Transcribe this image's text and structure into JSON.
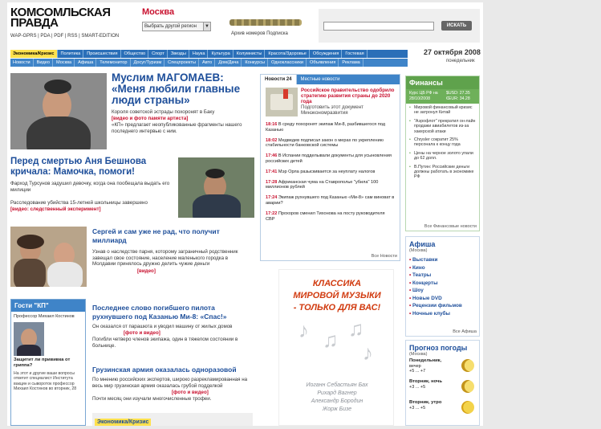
{
  "header": {
    "logo_line1_a": "КОМСОМ",
    "logo_line1_b": "ЛЬСКАЯ",
    "logo_line2": "ПРАВДА",
    "sublinks": "WAP-GPRS | PDA | PDF | RSS | SMART-EDITION",
    "city": "Москва",
    "region_select": "Выбрать другой регион",
    "archive_links": "Архив номеров   Подписка",
    "search_button": "ИСКАТЬ",
    "search_placeholder": ""
  },
  "nav": {
    "row1": [
      "Экономика/Кризис",
      "Политика",
      "Происшествия",
      "Общество",
      "Спорт",
      "Звезды",
      "Наука",
      "Культура",
      "Колумнисты",
      "Красота/Здоровье",
      "Обсуждения",
      "Гостевая"
    ],
    "row2": [
      "Новости",
      "Видео",
      "Москва",
      "Афиша",
      "Телемонитор",
      "Досуг/Туризм",
      "Спецпроекты",
      "Авто",
      "Дом/Дача",
      "Конкурсы",
      "Одноклассники",
      "Объявления",
      "Реклама"
    ]
  },
  "date": {
    "date": "27 октября 2008",
    "weekday": "понедельник"
  },
  "articles": {
    "a1_title": "Муслим МАГОМАЕВ: «Меня любили главные люди страны»",
    "a1_text": "Короля советской эстрады похоронят в Баку",
    "a1_link": "[видео и фото памяти артиста]",
    "a1_text2": "«КП» предлагает неопубликованные фрагменты нашего последнего интервью с ним.",
    "a2_title": "Перед смертью Аня Бешнова кричала: Мамочка, помоги!",
    "a2_text": "Фарход Турсунов задушил девочку, когда она пообещала выдать его милиции",
    "a2_text2": "Расследование убийства 15-летней школьницы завершено",
    "a2_link": "[видео: следственный эксперимент]",
    "a3_title": "Сергей и сам уже не рад, что получит миллиард",
    "a3_text": "Узнав о наследстве парня, которому заграничный родственник завещал свое состояние, население маленького городка в Молдавии принялось дружно делить чужие деньги",
    "a3_link": "[видео]",
    "a4_title": "Последнее слово погибшего пилота рухнувшего под Казанью Ми-8: «Спас!»",
    "a4_text": "Он оказался от парашюта и уводил машину от жилых домов",
    "a4_link": "[фото и видео]",
    "a4_text2": "Погибли четверо членов экипажа, один в тяжелом состоянии в больнице.",
    "a5_title": "Грузинская армия оказалась одноразовой",
    "a5_text": "По мнению российских экспертов, широко разрекламированная на весь мир грузинская армия оказалась грубой подделкой",
    "a5_link": "[фото и видео]",
    "a5_text2": "Почти месяц они изучали многочисленные трофеи."
  },
  "guests": {
    "title": "Гости \"КП\"",
    "person": "Профессор Михаил Костинов",
    "question": "Защитит ли прививка от гриппа?",
    "text": "На этот и другие ваши вопросы ответит специалист Института вакцин и сывороток профессор Михаил Костинов во вторник, 28"
  },
  "crisis_label": "Экономика/Кризис",
  "news24": {
    "tab1": "Новости 24",
    "tab2": "Местные новости",
    "lead_title": "Российское правительство одобрило стратегию развития страны до 2020 года",
    "lead_text": "Подготовить этот документ Минэкономразвития",
    "items": [
      {
        "time": "18:16",
        "text": "В среду похоронят экипаж Ми-8, разбившегося под Казанью"
      },
      {
        "time": "18:02",
        "text": "Медведев подписал закон о мерах по укреплению стабильности банковской системы"
      },
      {
        "time": "17:46",
        "text": "В Испании подделывали документы для усыновления российских детей"
      },
      {
        "time": "17:41",
        "text": "Мэр Орла разыскивается за неуплату налогов"
      },
      {
        "time": "17:28",
        "text": "Африканская чума на Ставрополье \"убила\" 100 миллионов рублей"
      },
      {
        "time": "17:24",
        "text": "Экипаж рухнувшего под Казанью «Ми-8» сам виноват в аварии?"
      },
      {
        "time": "17:22",
        "text": "Прохоров сменил Тихонова на посту руководителя СВР"
      }
    ],
    "all_link": "Все Новости"
  },
  "ad": {
    "line1": "КЛАССИКА",
    "line2": "МИРОВОЙ МУЗЫКИ",
    "line3": "- ТОЛЬКО ДЛЯ ВАС!",
    "names": [
      "Иоганн Себастьян Бах",
      "Рихард Вагнер",
      "Александр Бородин",
      "Жорж Бизе"
    ]
  },
  "finance": {
    "title": "Финансы",
    "rate_label": "Курс ЦБ РФ на 28/10/2008",
    "usd": "$USD: 27.35",
    "eur": "€EUR: 34.28",
    "items": [
      "Мировой финансовый кризис не затронул Китай",
      "\"Аэрофлот\" прекратил он-лайн продажи авиабилетов из-за хакерской атаки",
      "Chrysler сократит 25% персонала к концу года",
      "Цены на черное золото упали до 62 долл.",
      "В.Путин: Российские деньги должны работать в экономике РФ"
    ],
    "all_link": "Все Финансовые новости"
  },
  "afisha": {
    "title": "Афиша",
    "city": "(Москва)",
    "items": [
      "Выставки",
      "Кино",
      "Театры",
      "Концерты",
      "Шоу",
      "Новые DVD",
      "Рецензии фильмов",
      "Ночные клубы"
    ],
    "all_link": "Все Афиша"
  },
  "weather": {
    "title": "Прогноз погоды",
    "city": "(Москва)",
    "items": [
      {
        "day": "Понедельник,",
        "period": "вечер",
        "temp": "+5 ... +7"
      },
      {
        "day": "Вторник, ночь",
        "period": "",
        "temp": "+3 ... +5"
      },
      {
        "day": "Вторник, утро",
        "period": "",
        "temp": "+3 ... +5"
      }
    ]
  }
}
